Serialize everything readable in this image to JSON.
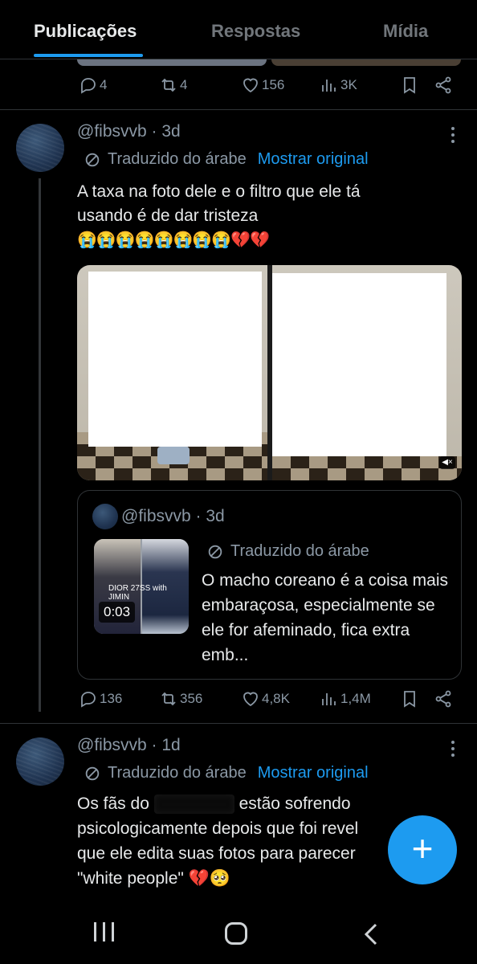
{
  "tabs": [
    {
      "label": "Publicações",
      "active": true
    },
    {
      "label": "Respostas",
      "active": false
    },
    {
      "label": "Mídia",
      "active": false
    }
  ],
  "prev_tweet": {
    "replies": "4",
    "retweets": "4",
    "likes": "156",
    "views": "3K"
  },
  "tweet1": {
    "handle": "@fibsvvb · 3d",
    "translated_label": "Traduzido do árabe",
    "show_original": "Mostrar original",
    "text_line1": "A taxa na foto dele e o filtro que ele tá",
    "text_line2": "usando é de dar tristeza",
    "emojis": "😭😭😭😭😭😭😭😭💔💔",
    "quote": {
      "handle": "@fibsvvb · 3d",
      "video_caption": "DIOR 27SS with JIMIN",
      "duration": "0:03",
      "translated_label": "Traduzido do árabe",
      "text": "O macho coreano é a coisa mais embaraçosa, especialmente se ele for afeminado, fica extra emb..."
    },
    "replies": "136",
    "retweets": "356",
    "likes": "4,8K",
    "views": "1,4M"
  },
  "tweet2": {
    "handle": "@fibsvvb · 1d",
    "translated_label": "Traduzido do árabe",
    "show_original": "Mostrar original",
    "text_a": "Os fãs do",
    "text_b": "estão sofrendo",
    "text_line2": "psicologicamente depois que foi revel",
    "text_line3": "que ele edita suas fotos para parecer",
    "text_line4": "\"white people\" 💔🥺"
  },
  "fab_label": "+",
  "colors": {
    "accent": "#1d9bf0",
    "background": "#000000",
    "muted": "#8b98a5"
  }
}
